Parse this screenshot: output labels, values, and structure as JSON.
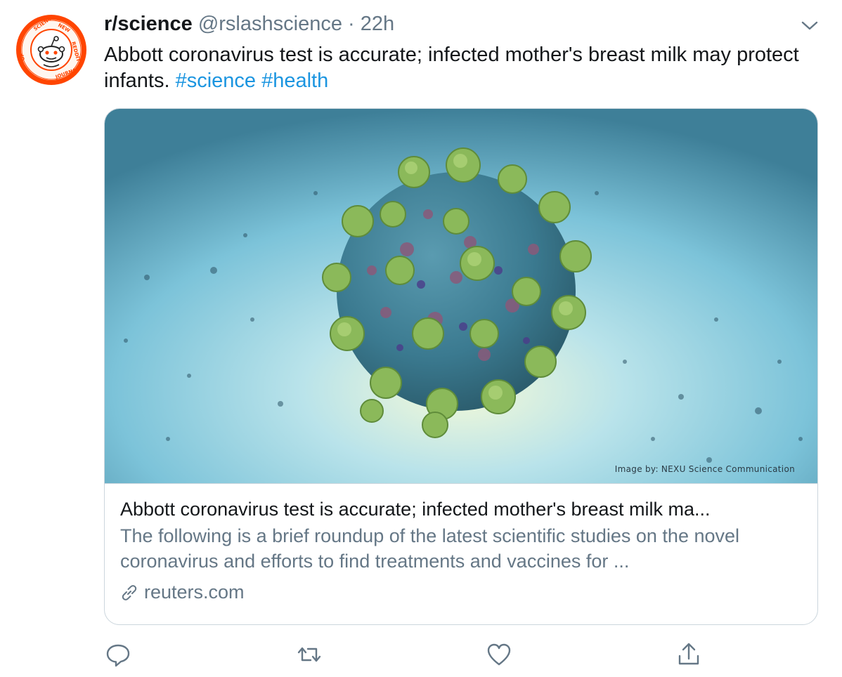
{
  "tweet": {
    "display_name": "r/science",
    "handle": "@rslashscience",
    "separator": "·",
    "time": "22h",
    "text_main": "Abbott coronavirus test is accurate; infected mother's breast milk may protect infants.",
    "hashtags": [
      "#science",
      "#health"
    ]
  },
  "card": {
    "image_credit": "Image by: NEXU Science Communication",
    "title": "Abbott coronavirus test is accurate; infected mother's breast milk ma...",
    "description": "The following is a brief roundup of the latest scientific studies on the novel coronavirus and efforts to find treatments and vaccines for ...",
    "domain": "reuters.com"
  },
  "avatar": {
    "logo_text": "SCIENCE · NEW REDDIT JOURNAL OF"
  },
  "icons": {
    "reply": "reply-icon",
    "retweet": "retweet-icon",
    "like": "like-icon",
    "share": "share-icon",
    "link": "link-icon",
    "menu": "chevron-down-icon"
  },
  "colors": {
    "text": "#14171a",
    "muted": "#657786",
    "link": "#1b95e0",
    "border": "#ccd6dd",
    "avatar_orange": "#ff4500"
  }
}
